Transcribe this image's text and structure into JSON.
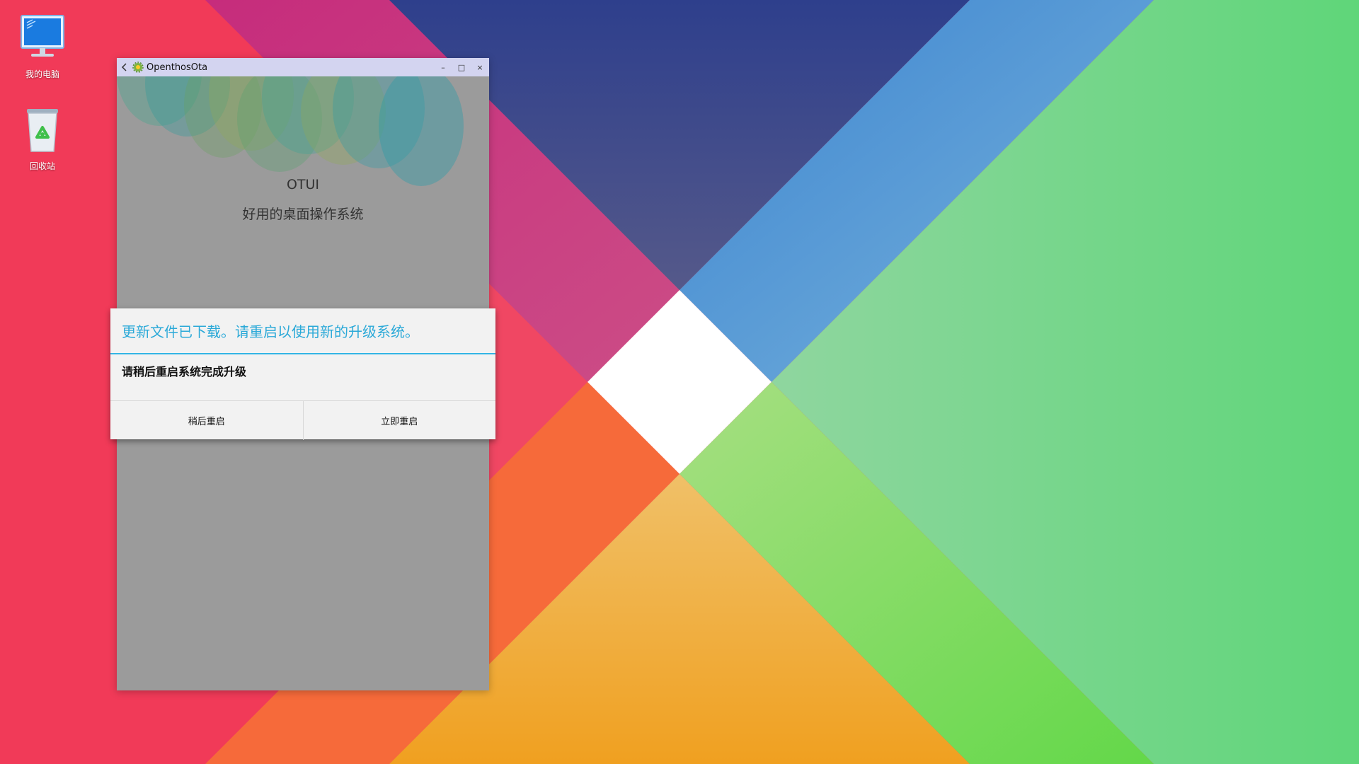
{
  "desktop": {
    "icons": [
      {
        "label": "我的电脑",
        "icon": "computer-monitor-icon"
      },
      {
        "label": "回收站",
        "icon": "recycle-bin-icon"
      }
    ]
  },
  "window": {
    "title": "OpenthosOta",
    "controls": {
      "minimize": "–",
      "maximize": "□",
      "close": "×"
    },
    "brand": "OTUI",
    "subtitle": "好用的桌面操作系统"
  },
  "dialog": {
    "title": "更新文件已下载。请重启以使用新的升级系统。",
    "message": "请稍后重启系统完成升级",
    "buttons": {
      "later": "稍后重启",
      "now": "立即重启"
    }
  },
  "colors": {
    "accent": "#33b5e5",
    "dialog_title": "#2ba9d8",
    "window_bg": "#9b9b9b",
    "titlebar_bg": "#d3d4f0"
  }
}
